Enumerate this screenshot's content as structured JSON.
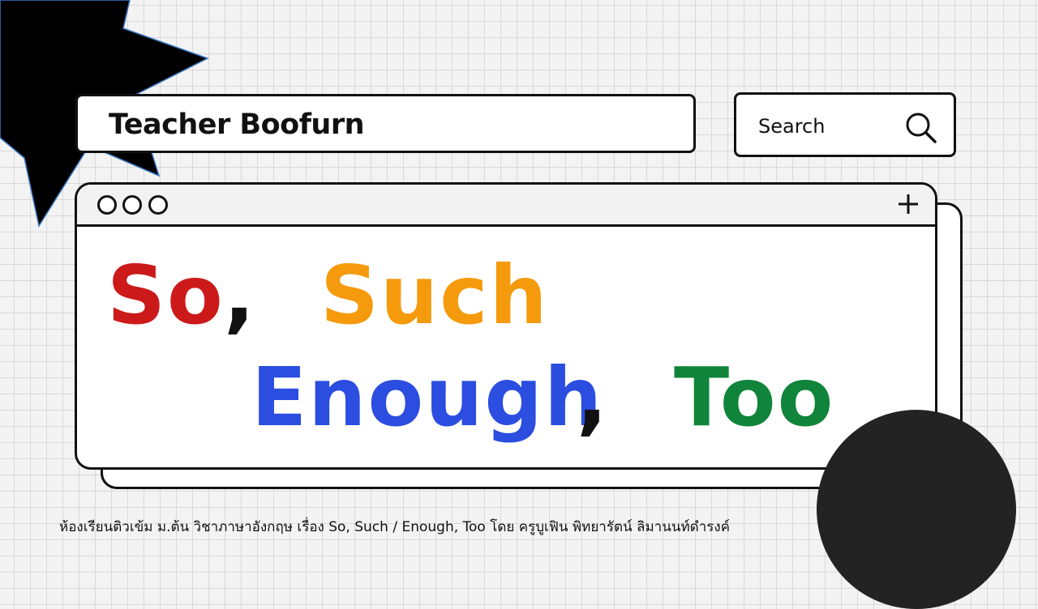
{
  "header": {
    "title": "Teacher Boofurn"
  },
  "search": {
    "label": "Search",
    "icon": "search-icon"
  },
  "window": {
    "controls": [
      "circle-icon",
      "circle-icon",
      "circle-icon"
    ],
    "add_icon": "plus-icon",
    "headline": {
      "word1": "So",
      "word2": "Such",
      "word3": "Enough",
      "word4": "Too",
      "separator": ","
    }
  },
  "caption": "ห้องเรียนติวเข้ม ม.ต้น วิชาภาษาอังกฤษ เรื่อง So, Such / Enough, Too  โดย ครูบูเฟิน พิทยารัตน์ ลิมานนท์ดำรงค์",
  "colors": {
    "so": "#cc1a1a",
    "such": "#f59a0c",
    "enough": "#2b4de0",
    "too": "#10843a",
    "border": "#111111",
    "circle": "#232323",
    "starburst": "#000000"
  }
}
